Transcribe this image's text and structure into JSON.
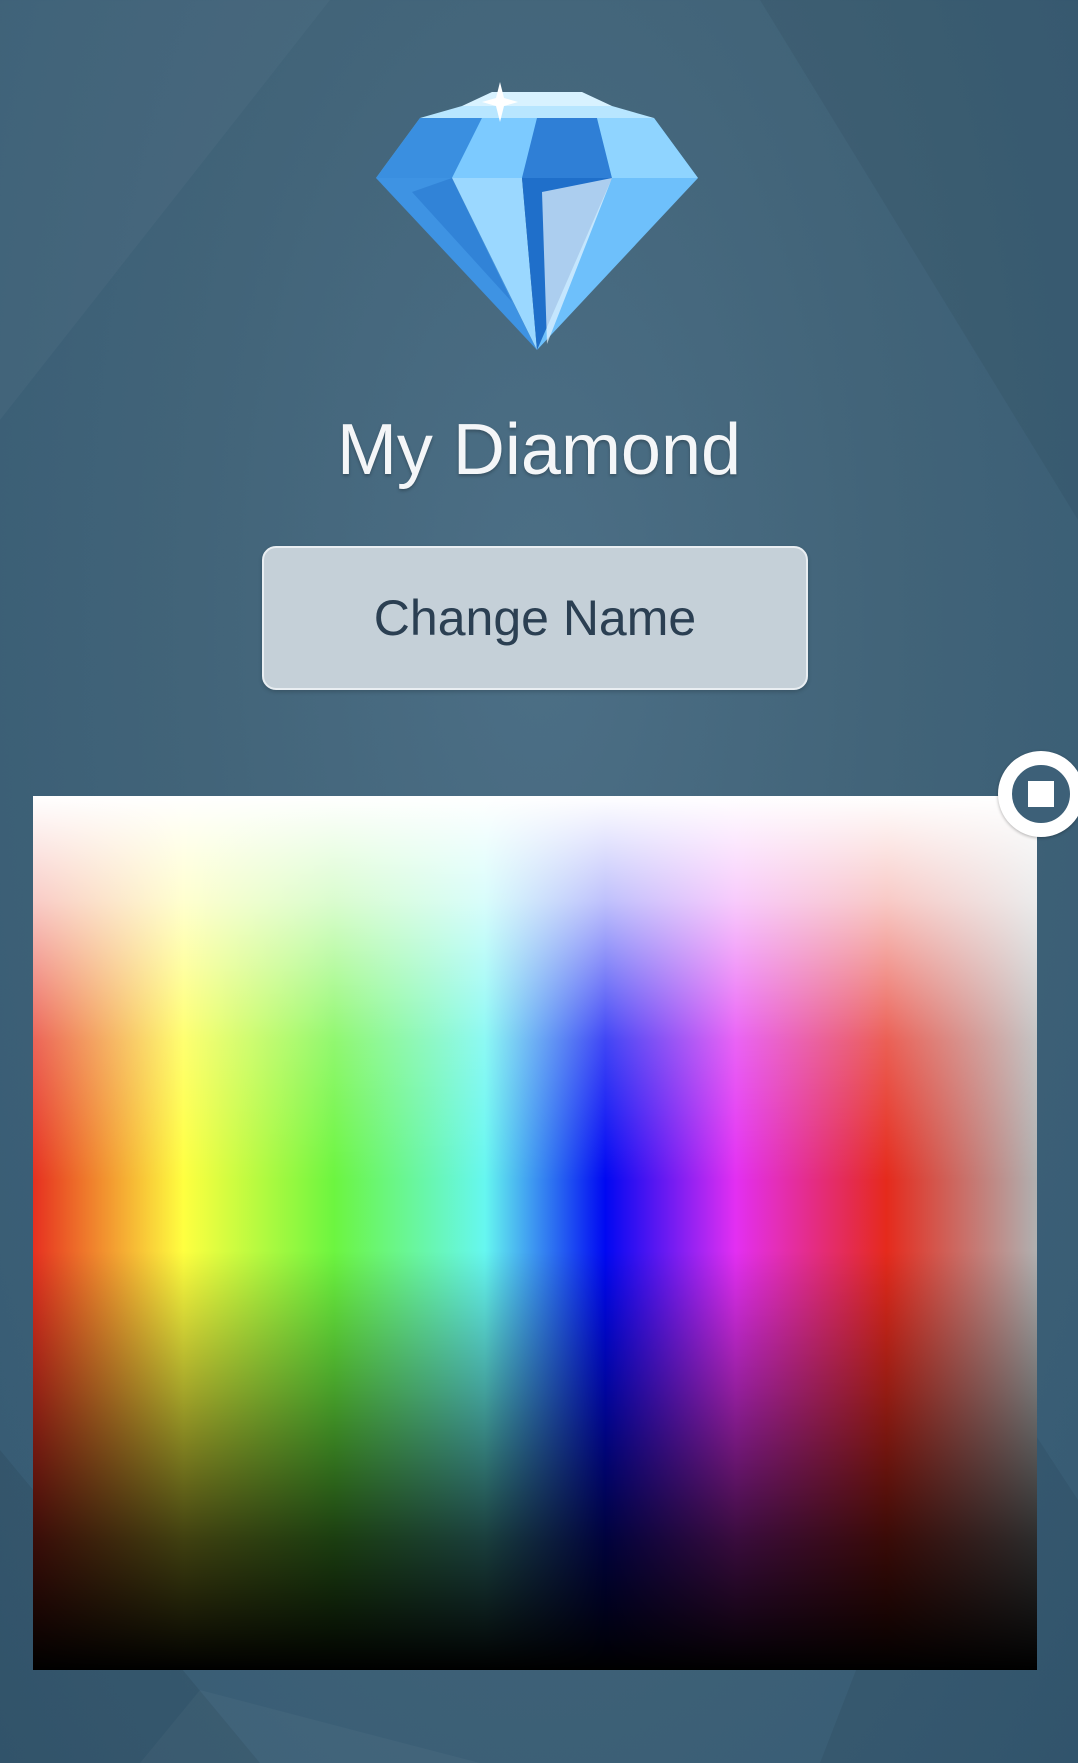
{
  "profile": {
    "title": "My Diamond",
    "icon": "diamond-icon"
  },
  "actions": {
    "change_name_label": "Change Name"
  },
  "color_picker": {
    "icon": "color-picker-handle-icon",
    "spectrum": [
      "#e63020",
      "#ffff40",
      "#6cf540",
      "#66f7f0",
      "#0008f2",
      "#e32ff2",
      "#e52a1c",
      "#b0b0b0"
    ]
  },
  "colors": {
    "background": "#426479",
    "button_fill": "#c5d0d8",
    "button_text": "#2b3f52",
    "title_text": "#f4f6f8"
  }
}
